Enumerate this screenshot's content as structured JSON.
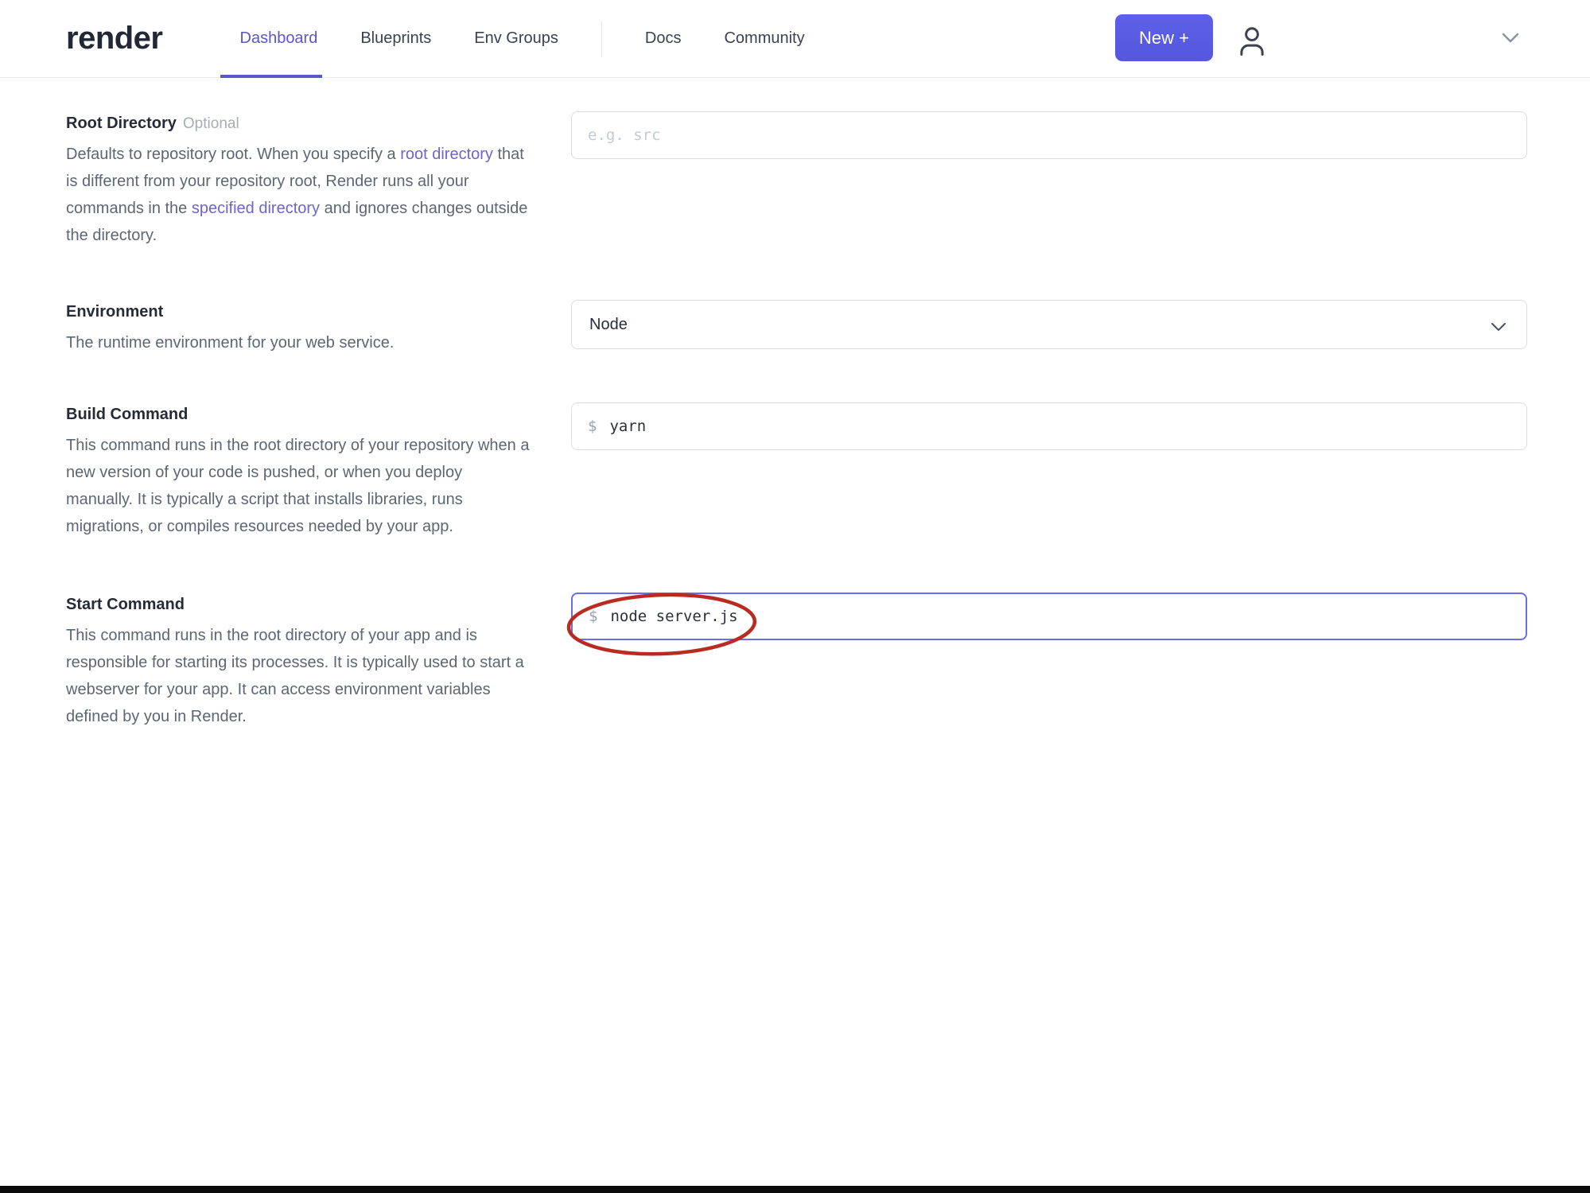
{
  "header": {
    "logo": "render",
    "nav": [
      {
        "label": "Dashboard",
        "active": true
      },
      {
        "label": "Blueprints",
        "active": false
      },
      {
        "label": "Env Groups",
        "active": false
      },
      {
        "label": "Docs",
        "active": false
      },
      {
        "label": "Community",
        "active": false
      }
    ],
    "new_button_label": "New +"
  },
  "form": {
    "root_directory": {
      "label": "Root Directory",
      "optional_badge": "Optional",
      "description_segments": [
        {
          "text": "Defaults to repository root. When you specify a "
        },
        {
          "text": "root directory",
          "link": true
        },
        {
          "text": " that is different from your repository root, Render runs all your commands in the "
        },
        {
          "text": "specified directory",
          "link": true
        },
        {
          "text": " and ignores changes outside the directory."
        }
      ],
      "input_value": "",
      "input_placeholder": "e.g. src"
    },
    "environment": {
      "label": "Environment",
      "description": "The runtime environment for your web service.",
      "selected_value": "Node"
    },
    "build_command": {
      "label": "Build Command",
      "description": "This command runs in the root directory of your repository when a new version of your code is pushed, or when you deploy manually. It is typically a script that installs libraries, runs migrations, or compiles resources needed by your app.",
      "prompt_prefix": "$",
      "input_value": "yarn"
    },
    "start_command": {
      "label": "Start Command",
      "description": "This command runs in the root directory of your app and is responsible for starting its processes. It is typically used to start a webserver for your app. It can access environment variables defined by you in Render.",
      "prompt_prefix": "$",
      "input_value": "node server.js",
      "focused": true
    }
  },
  "annotation": {
    "type": "hand-drawn-red-ellipse",
    "target": "start-command-input",
    "color": "#b92b21"
  },
  "colors": {
    "accent_purple": "#5b57c7",
    "button_indigo": "#575ce0",
    "focus_border": "#6a6ee0",
    "annotation_red": "#b92b21"
  }
}
